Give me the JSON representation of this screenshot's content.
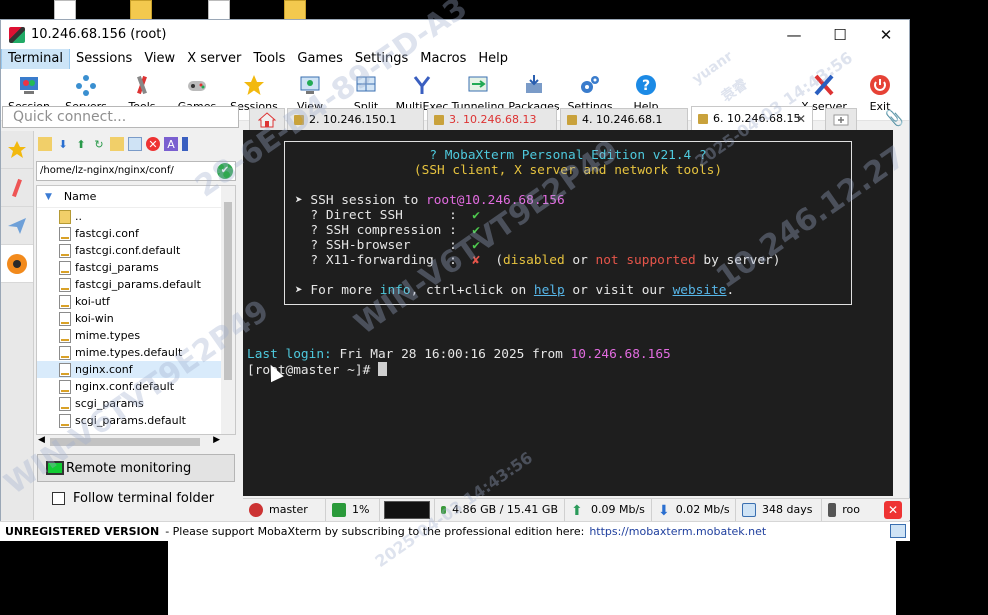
{
  "window": {
    "title": "10.246.68.156 (root)",
    "controls": {
      "minimize": "—",
      "maximize": "☐",
      "close": "✕"
    }
  },
  "menu": [
    "Terminal",
    "Sessions",
    "View",
    "X server",
    "Tools",
    "Games",
    "Settings",
    "Macros",
    "Help"
  ],
  "toolbar": [
    {
      "label": "Session",
      "icon": "session-icon"
    },
    {
      "label": "Servers",
      "icon": "servers-icon"
    },
    {
      "label": "Tools",
      "icon": "tools-icon"
    },
    {
      "label": "Games",
      "icon": "games-icon"
    },
    {
      "label": "Sessions",
      "icon": "star-icon"
    },
    {
      "label": "View",
      "icon": "view-icon"
    },
    {
      "label": "Split",
      "icon": "split-icon"
    },
    {
      "label": "MultiExec",
      "icon": "multiexec-icon"
    },
    {
      "label": "Tunneling",
      "icon": "tunneling-icon"
    },
    {
      "label": "Packages",
      "icon": "packages-icon"
    },
    {
      "label": "Settings",
      "icon": "gears-icon"
    },
    {
      "label": "Help",
      "icon": "help-icon"
    },
    {
      "label": "X server",
      "icon": "x-server-icon"
    },
    {
      "label": "Exit",
      "icon": "power-icon"
    }
  ],
  "quick_connect": {
    "placeholder": "Quick connect..."
  },
  "tabs": [
    {
      "label": "2. 10.246.150.1"
    },
    {
      "label": "3. 10.246.68.13"
    },
    {
      "label": "4. 10.246.68.1"
    },
    {
      "label": "6. 10.246.68.15"
    }
  ],
  "sftp": {
    "path": "/home/lz-nginx/nginx/conf/",
    "column_name": "Name",
    "files": [
      "..",
      "fastcgi.conf",
      "fastcgi.conf.default",
      "fastcgi_params",
      "fastcgi_params.default",
      "koi-utf",
      "koi-win",
      "mime.types",
      "mime.types.default",
      "nginx.conf",
      "nginx.conf.default",
      "scgi_params",
      "scgi_params.default"
    ],
    "selected_file": "nginx.conf",
    "remote_monitoring": "Remote monitoring",
    "follow_terminal": "Follow terminal folder"
  },
  "terminal": {
    "banner_title": "? MobaXterm Personal Edition v21.4 ?",
    "banner_subtitle": "(SSH client, X server and network tools)",
    "ssh_session_prefix": "➤ SSH session to ",
    "ssh_target": "root@10.246.68.156",
    "direct_ssh": "  ? Direct SSH      :  ",
    "ssh_compression": "  ? SSH compression :  ",
    "ssh_browser": "  ? SSH-browser     :  ",
    "x11": "  ? X11-forwarding  :  ",
    "check": "✔",
    "cross": "✘",
    "x11_note_1": "  (",
    "x11_disabled": "disabled",
    "x11_or": " or ",
    "x11_not_supported": "not supported",
    "x11_by_server": " by server)",
    "more_info_prefix": "➤ For more ",
    "info": "info",
    "ctrl_click": ", ctrl+click on ",
    "help": "help",
    "or_visit": " or visit our ",
    "website": "website",
    "period": ".",
    "last_login_label": "Last login:",
    "last_login_value": " Fri Mar 28 16:00:16 2025 from ",
    "last_login_ip": "10.246.68.165",
    "prompt": "[root@master ~]# "
  },
  "status": {
    "host": "master",
    "cpu": "1%",
    "memory": "4.86 GB / 15.41 GB",
    "upload": "0.09 Mb/s",
    "download": "0.02 Mb/s",
    "uptime": "348 days",
    "user": "roo"
  },
  "footer": {
    "unregistered": "UNREGISTERED VERSION",
    "message": " -  Please support MobaXterm by subscribing to the professional edition here:",
    "url": "https://mobaxterm.mobatek.net"
  },
  "watermarks": [
    "yuanr",
    "袁睿",
    "2025-04-03 14:43:56",
    "WIN-V6TVT9E2P49",
    "10.246.12.27",
    "28-6E-D4-89-FD-A3"
  ]
}
